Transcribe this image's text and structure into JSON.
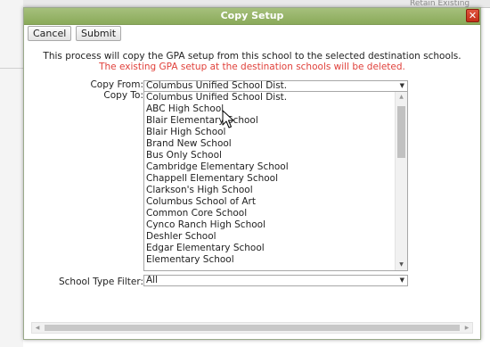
{
  "dialog": {
    "title": "Copy Setup",
    "close_glyph": "✕",
    "buttons": {
      "cancel": "Cancel",
      "submit": "Submit"
    },
    "description": "This process will copy the GPA setup from this school to the selected destination schools.",
    "warning": "The existing GPA setup at the destination schools will be deleted.",
    "copy_from": {
      "label": "Copy From:",
      "value": "Columbus Unified School Dist."
    },
    "copy_to": {
      "label": "Copy To:",
      "options": [
        "Columbus Unified School Dist.",
        "ABC High School",
        "Blair Elementary School",
        "Blair High School",
        "Brand New School",
        "Bus Only School",
        "Cambridge Elementary School",
        "Chappell Elementary School",
        "Clarkson's High School",
        "Columbus School of Art",
        "Common Core School",
        "Cynco Ranch High School",
        "Deshler School",
        "Edgar Elementary School",
        "Elementary School"
      ]
    },
    "school_type_filter": {
      "label": "School Type Filter:",
      "value": "All"
    }
  },
  "background": {
    "ghost_text": "Retain Existing"
  },
  "colors": {
    "titlebar": "#9ab46c",
    "warning": "#e0413b",
    "close": "#d1402a"
  },
  "icons": {
    "close": "close-icon",
    "dropdown": "chevron-down-icon",
    "scroll_up": "scroll-up-arrow-icon",
    "scroll_down": "scroll-down-arrow-icon",
    "cursor": "mouse-pointer-icon"
  }
}
